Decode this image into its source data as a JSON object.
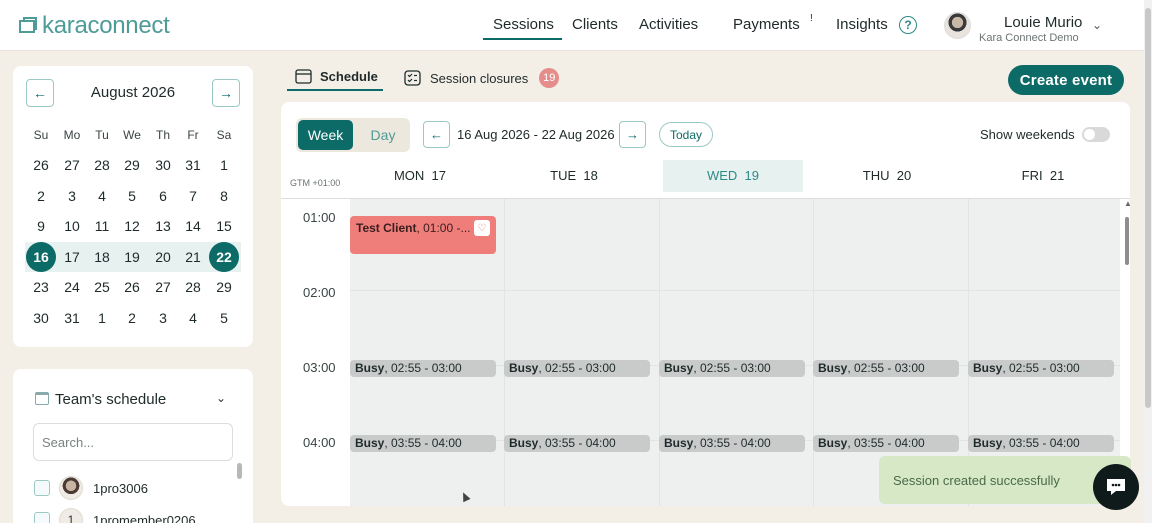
{
  "brand": {
    "name": "karaconnect"
  },
  "nav": {
    "items": [
      {
        "label": "Sessions",
        "active": true
      },
      {
        "label": "Clients"
      },
      {
        "label": "Activities"
      },
      {
        "label": "Payments",
        "superscript": "!"
      },
      {
        "label": "Insights"
      }
    ],
    "help_icon": "question-circle-icon"
  },
  "user": {
    "name": "Louie Murio",
    "org": "Kara Connect Demo"
  },
  "mini_calendar": {
    "title": "August 2026",
    "weekdays": [
      "Su",
      "Mo",
      "Tu",
      "We",
      "Th",
      "Fr",
      "Sa"
    ],
    "weeks": [
      [
        "26",
        "27",
        "28",
        "29",
        "30",
        "31",
        "1"
      ],
      [
        "2",
        "3",
        "4",
        "5",
        "6",
        "7",
        "8"
      ],
      [
        "9",
        "10",
        "11",
        "12",
        "13",
        "14",
        "15"
      ],
      [
        "16",
        "17",
        "18",
        "19",
        "20",
        "21",
        "22"
      ],
      [
        "23",
        "24",
        "25",
        "26",
        "27",
        "28",
        "29"
      ],
      [
        "30",
        "31",
        "1",
        "2",
        "3",
        "4",
        "5"
      ]
    ],
    "selected_range": {
      "start": "16",
      "end": "22"
    }
  },
  "team": {
    "title": "Team's schedule",
    "search_placeholder": "Search...",
    "members": [
      {
        "name": "1pro3006",
        "avatar": "photo"
      },
      {
        "name": "1promember0206",
        "avatar": "1"
      }
    ]
  },
  "tabs": {
    "schedule": "Schedule",
    "closures": "Session closures",
    "closures_count": "19"
  },
  "create_button": "Create event",
  "toolbar": {
    "week": "Week",
    "day": "Day",
    "range": "16 Aug 2026 - 22 Aug 2026",
    "today": "Today",
    "show_weekends": "Show weekends",
    "show_weekends_on": false
  },
  "timezone": "GTM +01:00",
  "columns": [
    {
      "day": "MON",
      "date": "17"
    },
    {
      "day": "TUE",
      "date": "18"
    },
    {
      "day": "WED",
      "date": "19",
      "today": true
    },
    {
      "day": "THU",
      "date": "20"
    },
    {
      "day": "FRI",
      "date": "21"
    }
  ],
  "hours": [
    "01:00",
    "02:00",
    "03:00",
    "04:00"
  ],
  "events": {
    "test_client": {
      "title": "Test Client",
      "time": ", 01:00 -..."
    },
    "busy_1": {
      "title": "Busy",
      "time": ", 02:55 - 03:00"
    },
    "busy_2": {
      "title": "Busy",
      "time": ", 03:55 - 04:00"
    }
  },
  "toast": "Session created successfully",
  "colors": {
    "primary": "#0d6b67",
    "logo": "#4f9b97",
    "badge": "#e48d8b",
    "test_event": "#ef7d7a",
    "busy_event": "#c9cbcb",
    "toast_bg": "#d6e8c5"
  }
}
